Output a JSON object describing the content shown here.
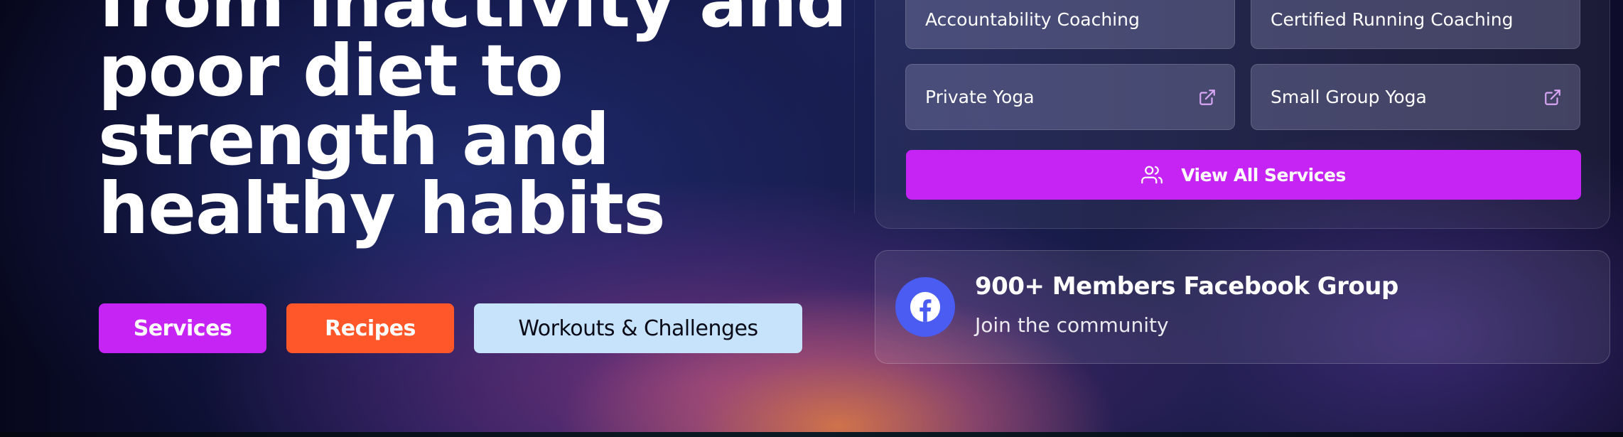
{
  "hero": {
    "headline_lines": [
      "from inactivity and",
      "poor diet to",
      "strength and",
      "healthy habits"
    ],
    "buttons": {
      "services": "Services",
      "recipes": "Recipes",
      "workouts": "Workouts & Challenges"
    }
  },
  "services_panel": {
    "cards": [
      {
        "label": "Accountability Coaching",
        "icon": "external-link-icon"
      },
      {
        "label": "Certified Running Coaching",
        "icon": "external-link-icon"
      },
      {
        "label": "Private Yoga",
        "icon": "external-link-icon"
      },
      {
        "label": "Small Group Yoga",
        "icon": "external-link-icon"
      }
    ],
    "view_all": {
      "label": "View All Services",
      "icon": "users-icon"
    }
  },
  "community": {
    "title": "900+ Members Facebook Group",
    "subtitle": "Join the community",
    "icon": "facebook-icon"
  },
  "colors": {
    "accent_purple": "#c524f5",
    "accent_orange": "#ff5729",
    "accent_light_blue": "#c6e3fb",
    "facebook_blue": "#4a5cf2",
    "external_icon": "#d9a6f5"
  }
}
